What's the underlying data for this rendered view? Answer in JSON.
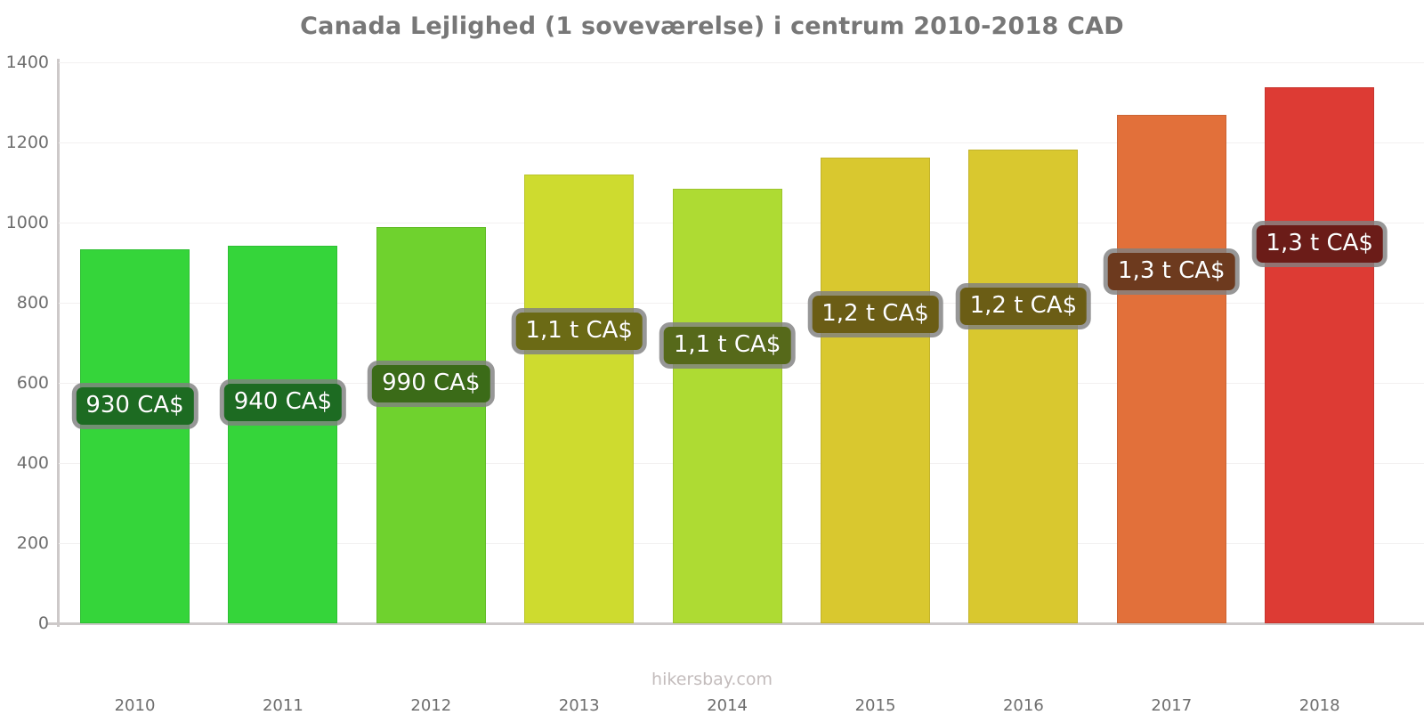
{
  "title": "Canada Lejlighed (1 soveværelse) i centrum 2010-2018 CAD",
  "footer": "hikersbay.com",
  "chart_data": {
    "type": "bar",
    "title": "Canada Lejlighed (1 soveværelse) i centrum 2010-2018 CAD",
    "xlabel": "",
    "ylabel": "",
    "ylim": [
      0,
      1400
    ],
    "ytick_step": 200,
    "grid": true,
    "legend": false,
    "currency": "CA$",
    "categories": [
      "2010",
      "2011",
      "2012",
      "2013",
      "2014",
      "2015",
      "2016",
      "2017",
      "2018"
    ],
    "values": [
      933,
      942,
      990,
      1120,
      1085,
      1163,
      1183,
      1270,
      1338
    ],
    "data_labels": [
      "930 CA$",
      "940 CA$",
      "990 CA$",
      "1,1 t CA$",
      "1,1 t CA$",
      "1,2 t CA$",
      "1,2 t CA$",
      "1,3 t CA$",
      "1,3 t CA$"
    ],
    "bar_colors": [
      "#35d53a",
      "#35d53a",
      "#6fd22e",
      "#cedb2f",
      "#aedb33",
      "#d9c82f",
      "#d9c82f",
      "#e2703a",
      "#dd3b34"
    ],
    "label_colors": [
      "#1d6b22",
      "#1d6b22",
      "#3b6b18",
      "#6b6a15",
      "#56691a",
      "#6b5d15",
      "#6b5d15",
      "#6d3a1e",
      "#6b1c18"
    ],
    "ytick_labels": [
      "0",
      "200",
      "400",
      "600",
      "800",
      "1000",
      "1200",
      "1400"
    ],
    "ytick_values": [
      0,
      200,
      400,
      600,
      800,
      1000,
      1200,
      1400
    ]
  }
}
